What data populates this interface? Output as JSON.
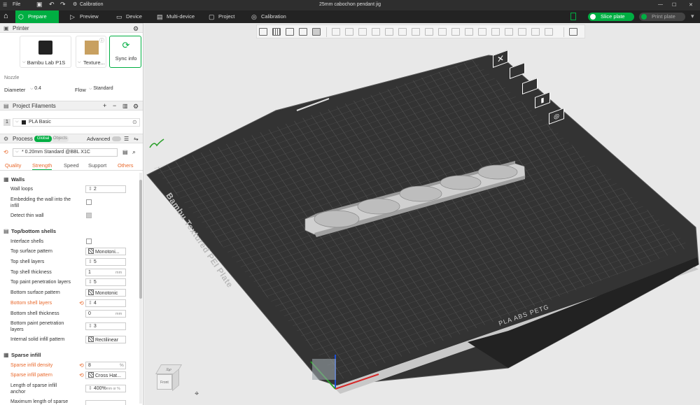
{
  "title_bar": {
    "file_menu": "File",
    "calibration": "Calibration",
    "window_title": "25mm cabochon pendant jig",
    "window_controls": [
      "—",
      "☐",
      "✕"
    ]
  },
  "main_tabs": [
    {
      "label": "Prepare",
      "icon": "cube-icon",
      "active": true
    },
    {
      "label": "Preview",
      "icon": "play-icon",
      "active": false
    },
    {
      "label": "Device",
      "icon": "device-icon",
      "active": false
    },
    {
      "label": "Multi-device",
      "icon": "multi-device-icon",
      "active": false
    },
    {
      "label": "Project",
      "icon": "project-icon",
      "active": false
    },
    {
      "label": "Calibration",
      "icon": "calibration-icon",
      "active": false
    }
  ],
  "slice_button": "Slice plate",
  "print_button": "Print plate",
  "printer": {
    "section_title": "Printer",
    "printer_name": "Bambu Lab P1S",
    "plate_name": "Texture...",
    "sync_button": "Sync info",
    "nozzle_label": "Nozzle",
    "diameter_label": "Diameter",
    "diameter_value": "0.4",
    "flow_label": "Flow",
    "flow_value": "Standard"
  },
  "filaments": {
    "section_title": "Project Filaments",
    "items": [
      {
        "index": "1",
        "name": "PLA Basic"
      }
    ]
  },
  "process": {
    "section_title": "Process",
    "global_label": "Global",
    "objects_label": "Objects",
    "advanced_label": "Advanced",
    "preset": "* 0.20mm Standard @BBL X1C",
    "tabs": [
      "Quality",
      "Strength",
      "Speed",
      "Support",
      "Others"
    ],
    "active_tab": "Strength"
  },
  "settings": {
    "walls_header": "Walls",
    "wall_loops_label": "Wall loops",
    "wall_loops_value": "2",
    "embed_label_1": "Embedding the wall into the",
    "embed_label_2": "infill",
    "detect_thin_label": "Detect thin wall",
    "topbottom_header": "Top/bottom shells",
    "interface_label": "Interface shells",
    "top_pattern_label": "Top surface pattern",
    "top_pattern_value": "Monotoni...",
    "top_layers_label": "Top shell layers",
    "top_layers_value": "5",
    "top_thickness_label": "Top shell thickness",
    "top_thickness_value": "1",
    "top_thickness_unit": "mm",
    "top_paint_label": "Top paint penetration layers",
    "top_paint_value": "5",
    "bottom_pattern_label": "Bottom surface pattern",
    "bottom_pattern_value": "Monotonic",
    "bottom_layers_label": "Bottom shell layers",
    "bottom_layers_value": "4",
    "bottom_thickness_label": "Bottom shell thickness",
    "bottom_thickness_value": "0",
    "bottom_thickness_unit": "mm",
    "bottom_paint_label_1": "Bottom paint penetration",
    "bottom_paint_label_2": "layers",
    "bottom_paint_value": "3",
    "internal_pattern_label": "Internal solid infill pattern",
    "internal_pattern_value": "Rectilinear",
    "sparse_header": "Sparse infill",
    "sparse_density_label": "Sparse infill density",
    "sparse_density_value": "8",
    "sparse_density_unit": "%",
    "sparse_pattern_label": "Sparse infill pattern",
    "sparse_pattern_value": "Cross Hat...",
    "sparse_anchor_label_1": "Length of sparse infill",
    "sparse_anchor_label_2": "anchor",
    "sparse_anchor_value": "400%",
    "sparse_anchor_unit": "mm or %",
    "max_sparse_label": "Maximum length of sparse"
  },
  "plate": {
    "side_label": "Bambu Textured PEI Plate",
    "front_label": "PLA ABS PETG",
    "plate_number": "1"
  },
  "view_cube": {
    "top": "Top",
    "front": "Front"
  },
  "colors": {
    "accent": "#00ae42",
    "orange": "#e9692c",
    "bed": "#3b3b3b",
    "grid": "#5a5a5a"
  }
}
